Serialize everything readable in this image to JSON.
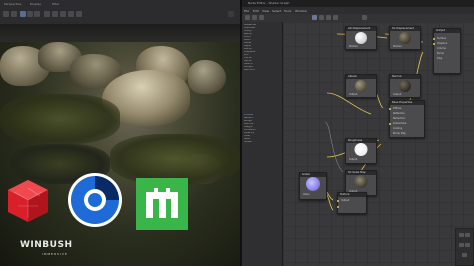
{
  "viewport": {
    "toolbar_labels": [
      "Perspective",
      "Display",
      "Filter"
    ]
  },
  "logos": {
    "watermark": "WINBUSH",
    "watermark_sub": "IMMERSIVE",
    "redshift_color": "#d81f2a",
    "cinema4d_color": "#1e6ad6",
    "mocha_color": "#39b54a",
    "mocha_letter": "m"
  },
  "editor": {
    "title": "Node Editor - Shader Graph",
    "menu": [
      "File",
      "Edit",
      "View",
      "Select",
      "Tools",
      "Window"
    ],
    "library_items": [
      "Materials",
      "Textures",
      "Utility",
      "Ramp",
      "Color",
      "Math",
      "Noise",
      "Layer",
      "Bump",
      "Displace",
      "Mix",
      "Curve",
      "Vector",
      "Switch",
      "Output",
      "Random"
    ],
    "library_list2": [
      "Diffuse",
      "Reflect",
      "Rough",
      "Normal",
      "Height",
      "Emission",
      "Opacity",
      "Coat",
      "Spec",
      "Sheen"
    ],
    "nodes": [
      {
        "id": "n1",
        "title": "AO Displacement",
        "rows": [
          "Texture",
          "Output"
        ]
      },
      {
        "id": "n2",
        "title": "SC Displacement",
        "rows": [
          "Texture",
          "Output"
        ]
      },
      {
        "id": "n3",
        "title": "Output",
        "rows": [
          "Surface",
          "Displace",
          "Volume",
          "Bump",
          "Disp"
        ]
      },
      {
        "id": "n4",
        "title": "Albedo",
        "rows": [
          "Output"
        ]
      },
      {
        "id": "n5",
        "title": "Normal",
        "rows": [
          "Output"
        ]
      },
      {
        "id": "n6",
        "title": "Base Properties",
        "rows": [
          "Diffuse",
          "Reflection",
          "Refraction",
          "Subsurface",
          "Coating",
          "Bump Map"
        ]
      },
      {
        "id": "n7",
        "title": "Roughness",
        "rows": [
          "Output"
        ]
      },
      {
        "id": "n8",
        "title": "SC Scale Map",
        "rows": [
          "Output"
        ]
      },
      {
        "id": "n9",
        "title": "Scalar",
        "rows": [
          "Value"
        ]
      },
      {
        "id": "n10",
        "title": "Texture",
        "rows": [
          "Output"
        ]
      }
    ]
  }
}
